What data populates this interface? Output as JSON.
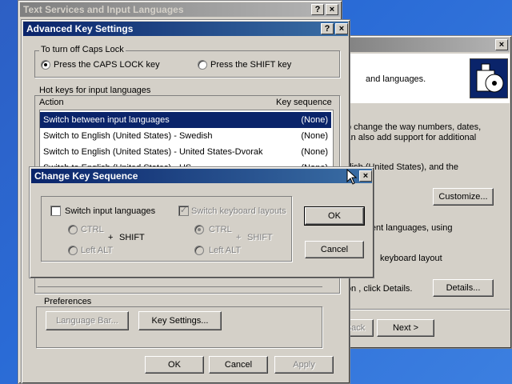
{
  "regional": {
    "text1": "and languages.",
    "text2": "o change the way numbers, dates,",
    "text3": "can also add support for additional",
    "text4": "nglish (United States), and the",
    "customize": "Customize...",
    "text5": "ny different languages, using",
    "text6": "keyboard layout",
    "text7": "ition , click Details.",
    "details": "Details...",
    "back": "Back",
    "next": "Next >"
  },
  "tsil": {
    "title": "Text Services and Input Languages",
    "help": "?",
    "close": "×"
  },
  "advanced": {
    "title": "Advanced Key Settings",
    "help": "?",
    "close": "×",
    "caps_group": "To turn off Caps Lock",
    "caps_opt1": "Press the CAPS LOCK key",
    "caps_opt2": "Press the SHIFT key",
    "hotkeys_group": "Hot keys for input languages",
    "col_action": "Action",
    "col_key": "Key sequence",
    "rows": [
      {
        "action": "Switch between input languages",
        "key": "(None)"
      },
      {
        "action": "Switch to English (United States) - Swedish",
        "key": "(None)"
      },
      {
        "action": "Switch to English (United States) - United States-Dvorak",
        "key": "(None)"
      },
      {
        "action": "Switch to English (United States) - US",
        "key": "(None)"
      }
    ],
    "prefs_group": "Preferences",
    "lang_bar": "Language Bar...",
    "key_settings": "Key Settings...",
    "ok": "OK",
    "cancel": "Cancel",
    "apply": "Apply"
  },
  "change": {
    "title": "Change Key Sequence",
    "close": "×",
    "switch_input": "Switch input languages",
    "switch_layouts": "Switch keyboard layouts",
    "ctrl": "CTRL",
    "left_alt": "Left ALT",
    "plus": "+",
    "shift": "SHIFT",
    "ok": "OK",
    "cancel": "Cancel"
  }
}
